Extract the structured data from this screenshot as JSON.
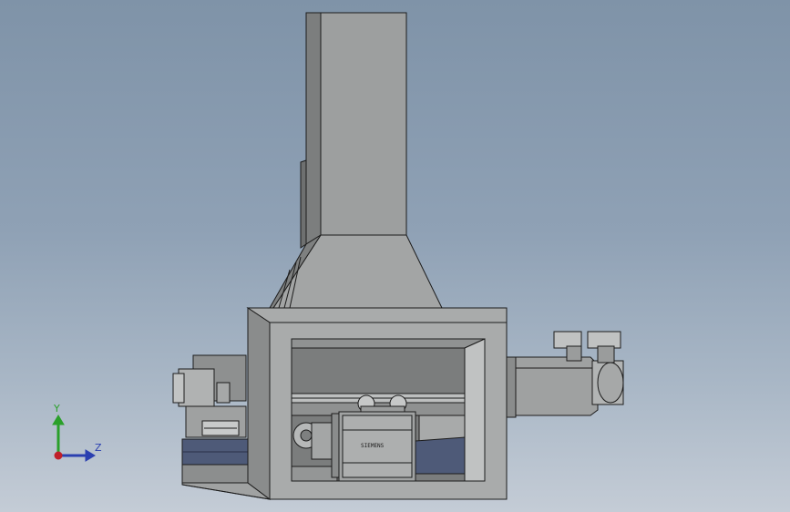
{
  "viewport": {
    "background_top": "#7f93a8",
    "background_bottom": "#c4ccd6"
  },
  "triad": {
    "y_label": "Y",
    "z_label": "Z",
    "y_color": "#2aa02a",
    "z_color": "#2a3fb0",
    "origin_color": "#c0202a"
  },
  "motor": {
    "brand_label": "SIEMENS"
  },
  "colors": {
    "part_fill": "#9a9c9c",
    "part_light": "#b4b6b6",
    "part_dark": "#6e7070",
    "edge": "#1c1c1c",
    "slide_blue": "#4e5a78"
  }
}
